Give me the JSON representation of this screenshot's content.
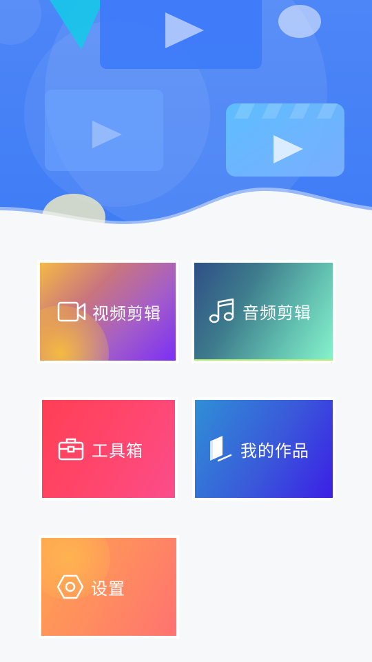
{
  "header": {
    "background_top": "#4d86f7",
    "background_bottom": "#3f7cf5"
  },
  "menu": {
    "video_edit_label": "视频剪辑",
    "audio_edit_label": "音频剪辑",
    "toolbox_label": "工具箱",
    "my_works_label": "我的作品",
    "settings_label": "设置"
  },
  "icons": {
    "video": "video-camera-icon",
    "audio": "music-note-icon",
    "toolbox": "toolbox-icon",
    "works": "book-icon",
    "settings": "hexagon-gear-icon"
  }
}
